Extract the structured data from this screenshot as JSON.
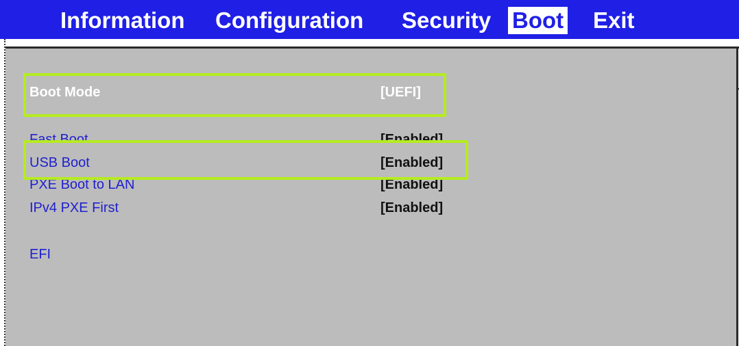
{
  "menu": {
    "tabs": [
      {
        "label": "Information"
      },
      {
        "label": "Configuration"
      },
      {
        "label": "Security"
      },
      {
        "label": "Boot"
      },
      {
        "label": "Exit"
      }
    ],
    "active_tab": "Boot"
  },
  "boot": {
    "items": [
      {
        "label": "Boot Mode",
        "value": "[UEFI]",
        "selected": true,
        "highlighted": true
      },
      {
        "label": "Fast Boot",
        "value": "[Enabled]"
      },
      {
        "label": "USB Boot",
        "value": "[Enabled]",
        "highlighted": true
      },
      {
        "label": "PXE Boot to LAN",
        "value": "[Enabled]"
      },
      {
        "label": "IPv4 PXE First",
        "value": "[Enabled]"
      }
    ],
    "section": "EFI"
  },
  "colors": {
    "menu_bg": "#1f1fe6",
    "panel_bg": "#bcbcbc",
    "item_text": "#1f1fcf",
    "highlight": "#b5ec1e"
  }
}
